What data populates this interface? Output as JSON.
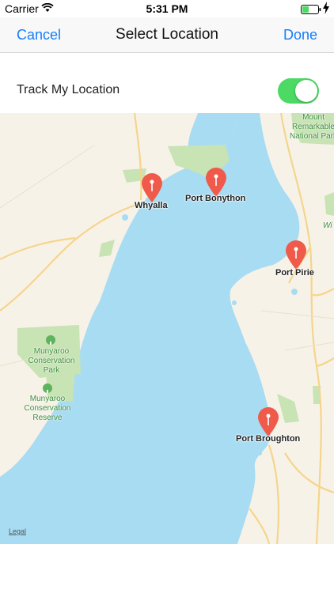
{
  "status_bar": {
    "carrier": "Carrier",
    "time": "5:31 PM"
  },
  "nav": {
    "cancel_label": "Cancel",
    "title": "Select Location",
    "done_label": "Done"
  },
  "track_row": {
    "label": "Track My Location",
    "enabled": true,
    "toggle_color": "#4cd964"
  },
  "map": {
    "towns": [
      {
        "label": "Whyalla"
      },
      {
        "label": "Port Bonython"
      },
      {
        "label": "Port Pirie"
      },
      {
        "label": "Port Broughton"
      }
    ],
    "parks": [
      {
        "label": "Munyaroo Conservation Park"
      },
      {
        "label": "Munyaroo Conservation Reserve"
      },
      {
        "label": "Mount Remarkable National Park"
      },
      {
        "label": "Wi"
      }
    ],
    "legal_label": "Legal",
    "water_color": "#a7dcf2",
    "land_color": "#f7f2e8",
    "park_color": "#c8e3b4",
    "pin_color": "#f05a4a"
  }
}
